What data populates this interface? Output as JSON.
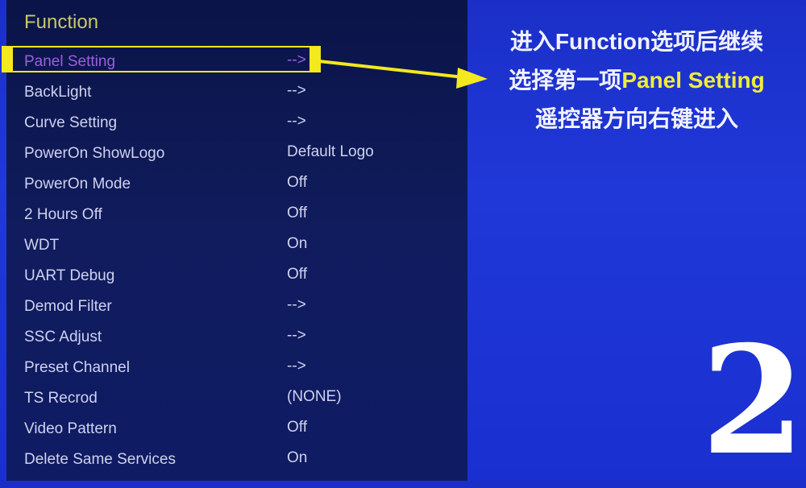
{
  "menu": {
    "title": "Function",
    "items": [
      {
        "label": "Panel Setting",
        "value": "-->"
      },
      {
        "label": "BackLight",
        "value": "-->"
      },
      {
        "label": "Curve Setting",
        "value": "-->"
      },
      {
        "label": "PowerOn ShowLogo",
        "value": "Default Logo"
      },
      {
        "label": "PowerOn Mode",
        "value": "Off"
      },
      {
        "label": "2 Hours Off",
        "value": "Off"
      },
      {
        "label": "WDT",
        "value": "On"
      },
      {
        "label": "UART Debug",
        "value": "Off"
      },
      {
        "label": "Demod Filter",
        "value": "-->"
      },
      {
        "label": "SSC Adjust",
        "value": "-->"
      },
      {
        "label": "Preset Channel",
        "value": "-->"
      },
      {
        "label": "TS Recrod",
        "value": "(NONE)"
      },
      {
        "label": "Video Pattern",
        "value": "Off"
      },
      {
        "label": "Delete Same Services",
        "value": "On"
      }
    ],
    "selected_index": 0
  },
  "annotation": {
    "line1": "进入Function选项后继续",
    "line2_prefix": "选择第一项",
    "line2_highlight": "Panel Setting",
    "line3": "遥控器方向右键进入",
    "step_number": "2",
    "highlight_color": "#f4e81e"
  }
}
